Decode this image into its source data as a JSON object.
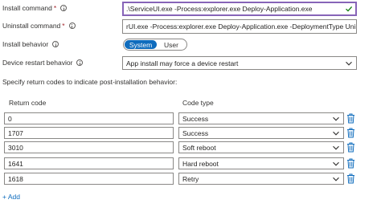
{
  "install_command": {
    "label": "Install command",
    "required_marker": "*",
    "value": ".\\ServiceUI.exe -Process:explorer.exe Deploy-Application.exe"
  },
  "uninstall_command": {
    "label": "Uninstall command",
    "required_marker": "*",
    "value": "rUI.exe -Process:explorer.exe Deploy-Application.exe -DeploymentType Uninstall"
  },
  "install_behavior": {
    "label": "Install behavior",
    "options": [
      "System",
      "User"
    ],
    "selected": "System"
  },
  "device_restart": {
    "label": "Device restart behavior",
    "value": "App install may force a device restart"
  },
  "return_codes": {
    "intro": "Specify return codes to indicate post-installation behavior:",
    "col_return_code": "Return code",
    "col_code_type": "Code type",
    "rows": [
      {
        "code": "0",
        "type": "Success"
      },
      {
        "code": "1707",
        "type": "Success"
      },
      {
        "code": "3010",
        "type": "Soft reboot"
      },
      {
        "code": "1641",
        "type": "Hard reboot"
      },
      {
        "code": "1618",
        "type": "Retry"
      }
    ],
    "add_label": "+ Add"
  },
  "colors": {
    "accent": "#0f6cbd",
    "focus_border": "#8764b8",
    "valid_check": "#107c10",
    "required": "#a4262c"
  }
}
